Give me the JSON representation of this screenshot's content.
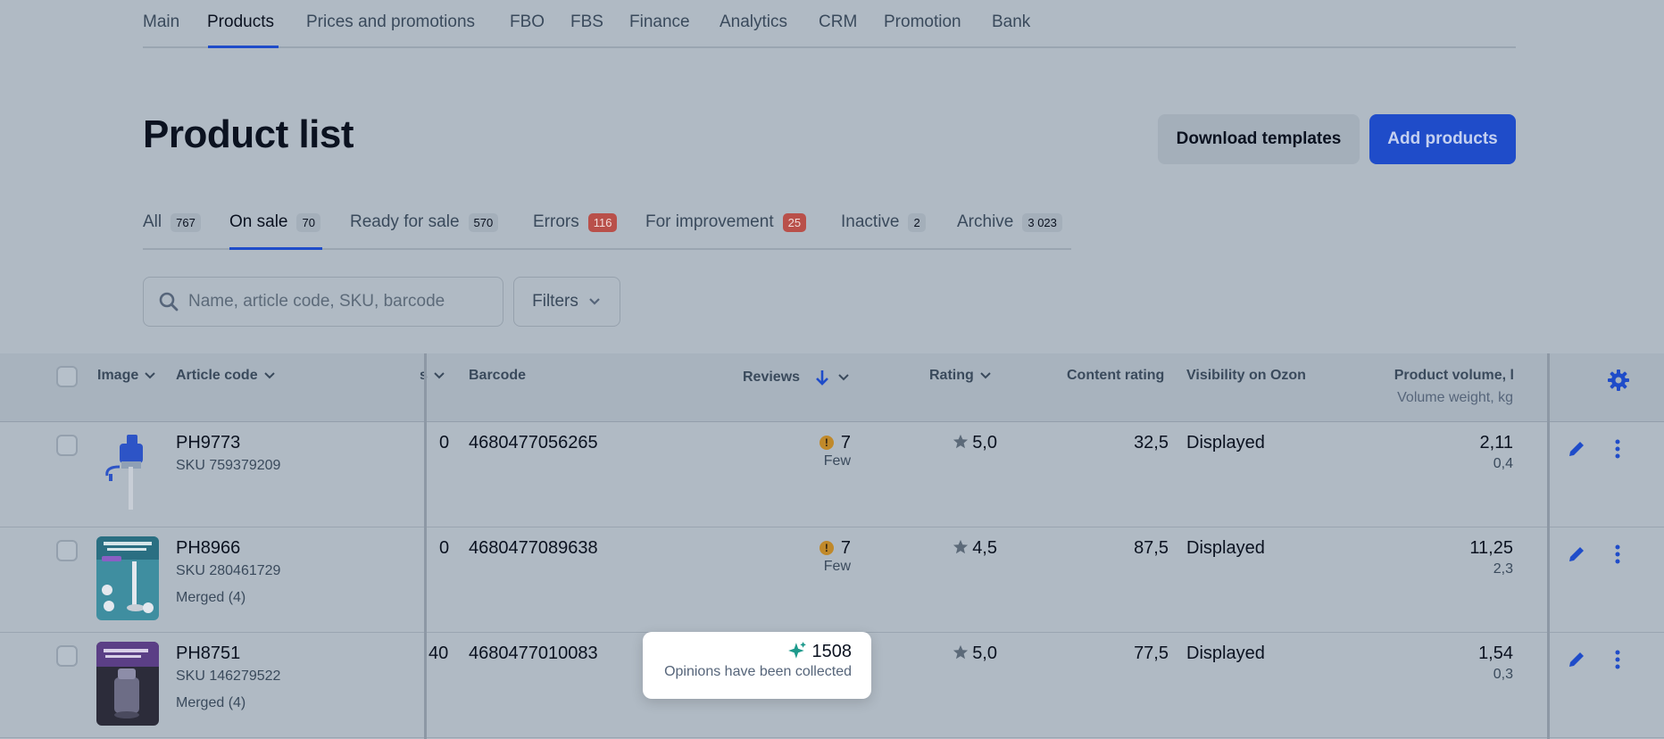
{
  "nav": {
    "items": [
      "Main",
      "Products",
      "Prices and promotions",
      "FBO",
      "FBS",
      "Finance",
      "Analytics",
      "CRM",
      "Promotion",
      "Bank"
    ],
    "active": "Products"
  },
  "header": {
    "title": "Product list",
    "download_label": "Download templates",
    "add_label": "Add products"
  },
  "tabs": [
    {
      "label": "All",
      "count": "767"
    },
    {
      "label": "On sale",
      "count": "70"
    },
    {
      "label": "Ready for sale",
      "count": "570"
    },
    {
      "label": "Errors",
      "count": "116"
    },
    {
      "label": "For improvement",
      "count": "25"
    },
    {
      "label": "Inactive",
      "count": "2"
    },
    {
      "label": "Archive",
      "count": "3 023"
    }
  ],
  "search": {
    "placeholder": "Name, article code, SKU, barcode"
  },
  "filters": {
    "label": "Filters"
  },
  "table": {
    "headers": {
      "image": "Image",
      "article": "Article code",
      "hidden": "s",
      "barcode": "Barcode",
      "reviews": "Reviews",
      "rating": "Rating",
      "content_rating": "Content rating",
      "visibility": "Visibility on Ozon",
      "volume": "Product volume, l",
      "volume_weight": "Volume weight, kg"
    },
    "rows": [
      {
        "article": "PH9773",
        "sku": "SKU 759379209",
        "merged": "",
        "stock": "0",
        "barcode": "4680477056265",
        "reviews": "7",
        "reviews_note": "Few",
        "rating": "5,0",
        "content_rating": "32,5",
        "visibility": "Displayed",
        "volume": "2,11",
        "weight": "0,4"
      },
      {
        "article": "PH8966",
        "sku": "SKU 280461729",
        "merged": "Merged (4)",
        "stock": "0",
        "barcode": "4680477089638",
        "reviews": "7",
        "reviews_note": "Few",
        "rating": "4,5",
        "content_rating": "87,5",
        "visibility": "Displayed",
        "volume": "11,25",
        "weight": "2,3"
      },
      {
        "article": "PH8751",
        "sku": "SKU 146279522",
        "merged": "Merged (4)",
        "stock": "40",
        "barcode": "4680477010083",
        "reviews": "1508",
        "reviews_note": "Opinions have been collected",
        "rating": "5,0",
        "content_rating": "77,5",
        "visibility": "Displayed",
        "volume": "1,54",
        "weight": "0,3"
      }
    ]
  },
  "colors": {
    "accent": "#1f4cc9",
    "warning": "#c0892a",
    "danger": "#b9504a"
  }
}
